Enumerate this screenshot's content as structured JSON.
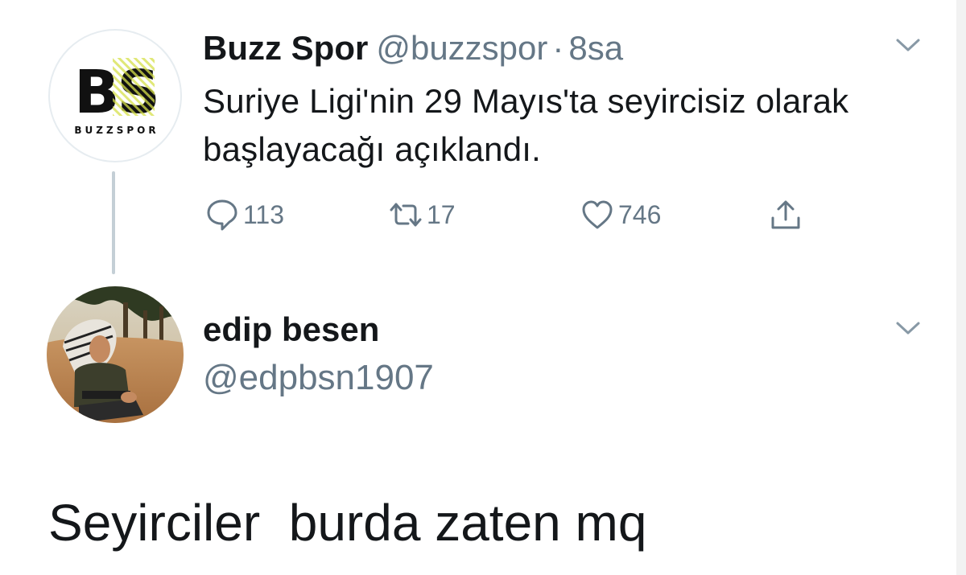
{
  "tweet": {
    "display_name": "Buzz Spor",
    "handle": "@buzzspor",
    "separator": "·",
    "time": "8sa",
    "text": "Suriye Ligi'nin 29 Mayıs'ta seyircisiz olarak başlayacağı açıklandı.",
    "avatar": {
      "logo_letters": "BS",
      "logo_caption": "BUZZSPOR"
    },
    "actions": {
      "reply_count": "113",
      "retweet_count": "17",
      "like_count": "746"
    }
  },
  "reply": {
    "display_name": "edip besen",
    "handle": "@edpbsn1907",
    "text": "Seyirciler  burda zaten mq"
  },
  "colors": {
    "text": "#14171a",
    "secondary": "#657786",
    "thread_line": "#c4cfd6",
    "logo_accent": "#d6e04a"
  }
}
